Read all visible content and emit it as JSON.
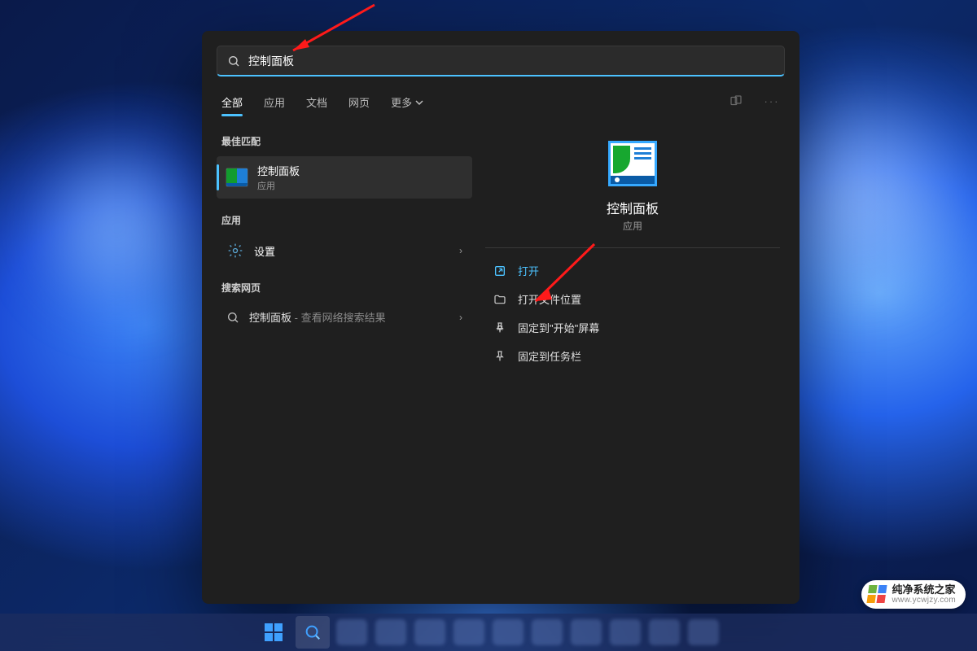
{
  "search": {
    "query": "控制面板"
  },
  "tabs": {
    "all": "全部",
    "apps": "应用",
    "documents": "文档",
    "web": "网页",
    "more": "更多"
  },
  "sections": {
    "best_match": "最佳匹配",
    "apps": "应用",
    "search_web": "搜索网页"
  },
  "results": {
    "control_panel": {
      "title": "控制面板",
      "subtitle": "应用"
    },
    "settings": {
      "title": "设置"
    },
    "web": {
      "prefix": "控制面板",
      "suffix": " - 查看网络搜索结果"
    }
  },
  "detail": {
    "title": "控制面板",
    "subtitle": "应用",
    "actions": {
      "open": "打开",
      "open_location": "打开文件位置",
      "pin_start": "固定到\"开始\"屏幕",
      "pin_taskbar": "固定到任务栏"
    }
  },
  "watermark": {
    "title": "纯净系统之家",
    "url": "www.ycwjzy.com"
  }
}
